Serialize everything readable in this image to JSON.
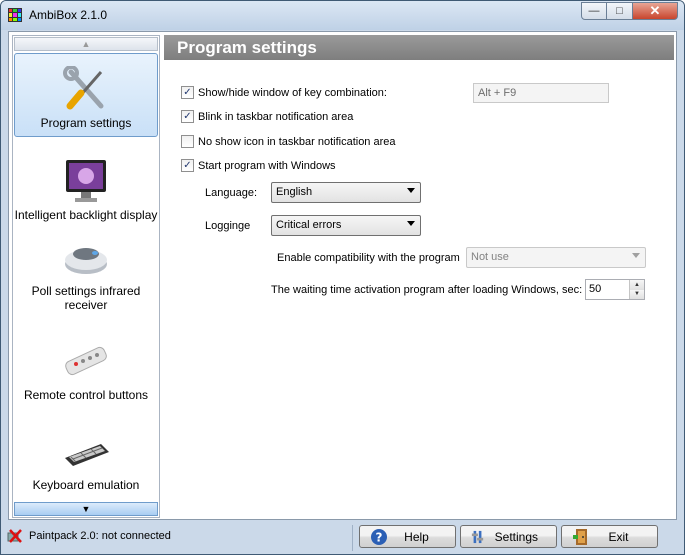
{
  "window": {
    "title": "AmbiBox 2.1.0"
  },
  "sidebar": {
    "items": [
      {
        "label": "Program settings",
        "icon": "tools-icon",
        "active": true
      },
      {
        "label": "Intelligent backlight display",
        "icon": "monitor-icon",
        "active": false
      },
      {
        "label": "Poll settings infrared receiver",
        "icon": "ir-receiver-icon",
        "active": false
      },
      {
        "label": "Remote control buttons",
        "icon": "remote-control-icon",
        "active": false
      },
      {
        "label": "Keyboard emulation",
        "icon": "keyboard-icon",
        "active": false
      }
    ]
  },
  "main": {
    "title": "Program settings",
    "checkboxes": [
      {
        "label": "Show/hide window of key combination:",
        "checked": true
      },
      {
        "label": "Blink in taskbar notification area",
        "checked": true
      },
      {
        "label": "No show icon in taskbar notification area",
        "checked": false
      },
      {
        "label": "Start program with Windows",
        "checked": true
      }
    ],
    "hotkey_value": "Alt + F9",
    "language_label": "Language:",
    "language_value": "English",
    "logging_label": "Logginge",
    "logging_value": "Critical errors",
    "compat_label": "Enable compatibility with the program",
    "compat_value": "Not use",
    "wait_label": "The waiting time activation program after loading Windows, sec:",
    "wait_value": "50"
  },
  "status": {
    "text": "Paintpack 2.0: not connected",
    "help_label": "Help",
    "settings_label": "Settings",
    "exit_label": "Exit"
  },
  "colors": {
    "accent": "#6f9ccb",
    "header": "#8a8a8a",
    "frame": "#cbd9e9"
  }
}
